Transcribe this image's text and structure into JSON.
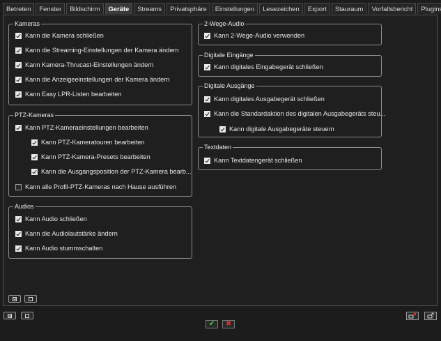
{
  "tabs": [
    "Betreten",
    "Fenster",
    "Bildschirm",
    "Geräte",
    "Streams",
    "Privatsphäre",
    "Einstellungen",
    "Lesezeichen",
    "Export",
    "Stauraum",
    "Vorfallsbericht",
    "Plugins"
  ],
  "active_tab": "Geräte",
  "groups": {
    "kameras": {
      "title": "Kameras",
      "items": [
        {
          "label": "Kann die Kamera schließen",
          "checked": true
        },
        {
          "label": "Kann die Streaming-Einstellungen der Kamera ändern",
          "checked": true
        },
        {
          "label": "Kann Kamera-Thrucast-Einstellungen ändern",
          "checked": true
        },
        {
          "label": "Kann die Anzeigeeinstellungen der Kamera ändern",
          "checked": true
        },
        {
          "label": "Kann Easy LPR-Listen bearbeiten",
          "checked": true
        }
      ]
    },
    "ptz": {
      "title": "PTZ-Kameras",
      "items": [
        {
          "label": "Kann PTZ-Kameraeinstellungen bearbeiten",
          "checked": true
        },
        {
          "label": "Kann PTZ-Kameratouren bearbeiten",
          "checked": true
        },
        {
          "label": "Kann PTZ-Kamera-Presets bearbeiten",
          "checked": true
        },
        {
          "label": "Kann die Ausgangsposition der PTZ-Kamera bearb...",
          "checked": true
        },
        {
          "label": "Kann alle Profil-PTZ-Kameras nach Hause ausführen",
          "checked": false
        }
      ]
    },
    "audios": {
      "title": "Audios",
      "items": [
        {
          "label": "Kann Audio schließen",
          "checked": true
        },
        {
          "label": "Kann die Audiolautstärke ändern",
          "checked": true
        },
        {
          "label": "Kann Audio stummschalten",
          "checked": true
        }
      ]
    },
    "twoway": {
      "title": "2-Wege-Audio",
      "items": [
        {
          "label": "Kann 2-Wege-Audio verwenden",
          "checked": true
        }
      ]
    },
    "din": {
      "title": "Digitale Eingänge",
      "items": [
        {
          "label": "Kann digitales Eingabegerät schließen",
          "checked": true
        }
      ]
    },
    "dout": {
      "title": "Digitale Ausgänge",
      "items": [
        {
          "label": "Kann digitales Ausgabegerät schließen",
          "checked": true
        },
        {
          "label": "Kann die Standardaktion des digitalen Ausgabegeräts steu...",
          "checked": true
        },
        {
          "label": "Kann digitale Ausgabegeräte steuern",
          "checked": true
        }
      ]
    },
    "text": {
      "title": "Textdaten",
      "items": [
        {
          "label": "Kann Textdatengerät schließen",
          "checked": true
        }
      ]
    }
  },
  "buttons": {
    "ok_glyph": "✔",
    "cancel_glyph": "✖"
  },
  "colors": {
    "background": "#1c1c1c",
    "ok": "#44d644",
    "cancel": "#e03030"
  }
}
